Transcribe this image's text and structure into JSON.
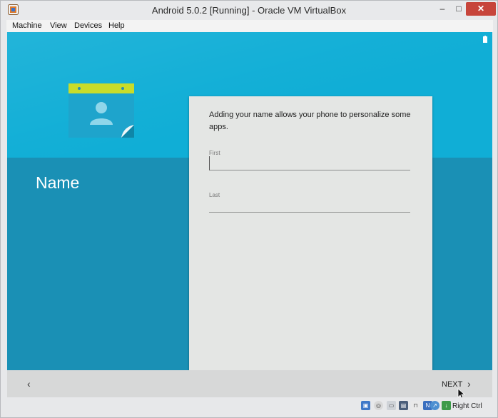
{
  "window": {
    "title": "Android 5.0.2 [Running] - Oracle VM VirtualBox",
    "minimize_glyph": "–",
    "maximize_glyph": "□",
    "close_glyph": "✕"
  },
  "menubar": {
    "items": [
      {
        "label": "Machine"
      },
      {
        "label": "View"
      },
      {
        "label": "Devices"
      },
      {
        "label": "Help"
      }
    ]
  },
  "setup": {
    "step_title": "Name",
    "description": "Adding your name allows your phone to personalize some apps.",
    "first_label": "First",
    "first_value": "",
    "last_label": "Last",
    "last_value": ""
  },
  "navbar": {
    "back_glyph": "‹",
    "next_label": "NEXT",
    "next_glyph": "›"
  },
  "statusbar": {
    "host_key": "Right Ctrl"
  },
  "colors": {
    "hero": "#10aed6",
    "background": "#1a90b5",
    "card": "#e4e6e4",
    "close_button": "#c7453b",
    "icon_header": "#c8dc2a"
  },
  "icons": {
    "app": "virtualbox-icon",
    "contact": "contact-card-icon",
    "status": "battery-icon"
  }
}
